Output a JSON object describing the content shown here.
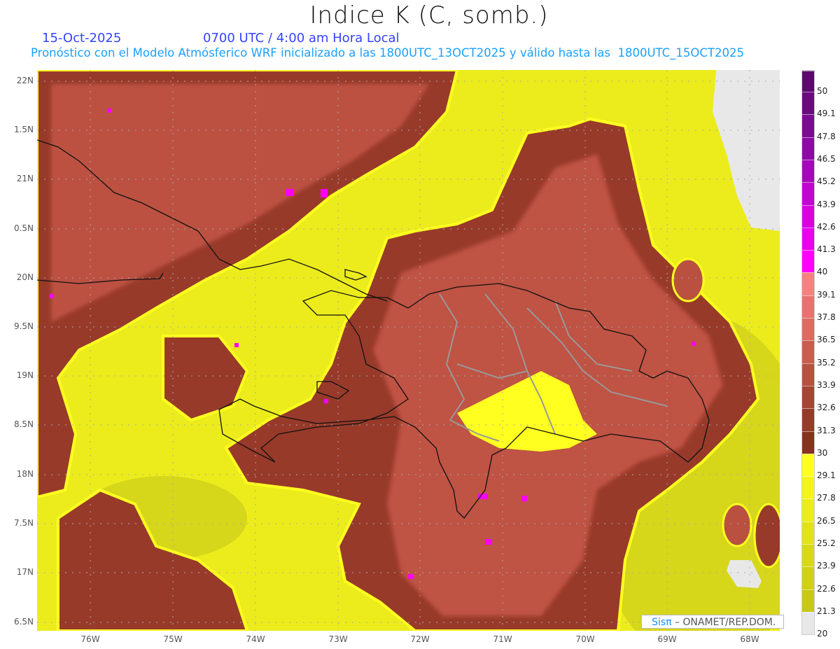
{
  "header": {
    "title": "Indice K (C, somb.)",
    "date": "15-Oct-2025",
    "time": "0700 UTC / 4:00 am Hora Local",
    "description": "Pronóstico con el Modelo Atmósferico WRF inicializado a las 1800UTC_13OCT2025 y válido hasta las  1800UTC_15OCT2025"
  },
  "axes": {
    "lat_labels": [
      "22N",
      "1.5N",
      "21N",
      "0.5N",
      "20N",
      "9.5N",
      "19N",
      "8.5N",
      "18N",
      "7.5N",
      "17N",
      "6.5N"
    ],
    "lon_labels": [
      "76W",
      "75W",
      "74W",
      "73W",
      "72W",
      "71W",
      "70W",
      "69W",
      "68W"
    ]
  },
  "colorbar": {
    "labels": [
      "50",
      "49.1",
      "47.8",
      "46.5",
      "45.2",
      "43.9",
      "42.6",
      "41.3",
      "40",
      "39.1",
      "37.8",
      "36.5",
      "35.2",
      "33.9",
      "32.6",
      "31.3",
      "30",
      "29.1",
      "27.8",
      "26.5",
      "25.2",
      "23.9",
      "22.6",
      "21.3",
      "20"
    ],
    "colors": [
      "#5a0a6a",
      "#6a0a80",
      "#7d0a94",
      "#9008a8",
      "#a806bc",
      "#c204d0",
      "#d802e0",
      "#e800ec",
      "#ff00ff",
      "#f88080",
      "#ec7070",
      "#e06a60",
      "#cc5c4e",
      "#b95040",
      "#a84434",
      "#983a2a",
      "#86321c",
      "#ffff20",
      "#f4f41a",
      "#ecec1c",
      "#e2e21c",
      "#d8d81a",
      "#d0d018",
      "#c8c818",
      "#e8e8e8"
    ]
  },
  "credit": {
    "brand": "Sisπ",
    "text": " –  ONAMET/REP.DOM."
  },
  "palette": {
    "dark_brown": "#86321c",
    "brown": "#a84434",
    "salmon": "#cc5c4e",
    "yellow": "#f2f21a",
    "olive": "#d6d61a",
    "gray": "#e8e8e8",
    "border": "#999999",
    "coast": "#111111"
  }
}
